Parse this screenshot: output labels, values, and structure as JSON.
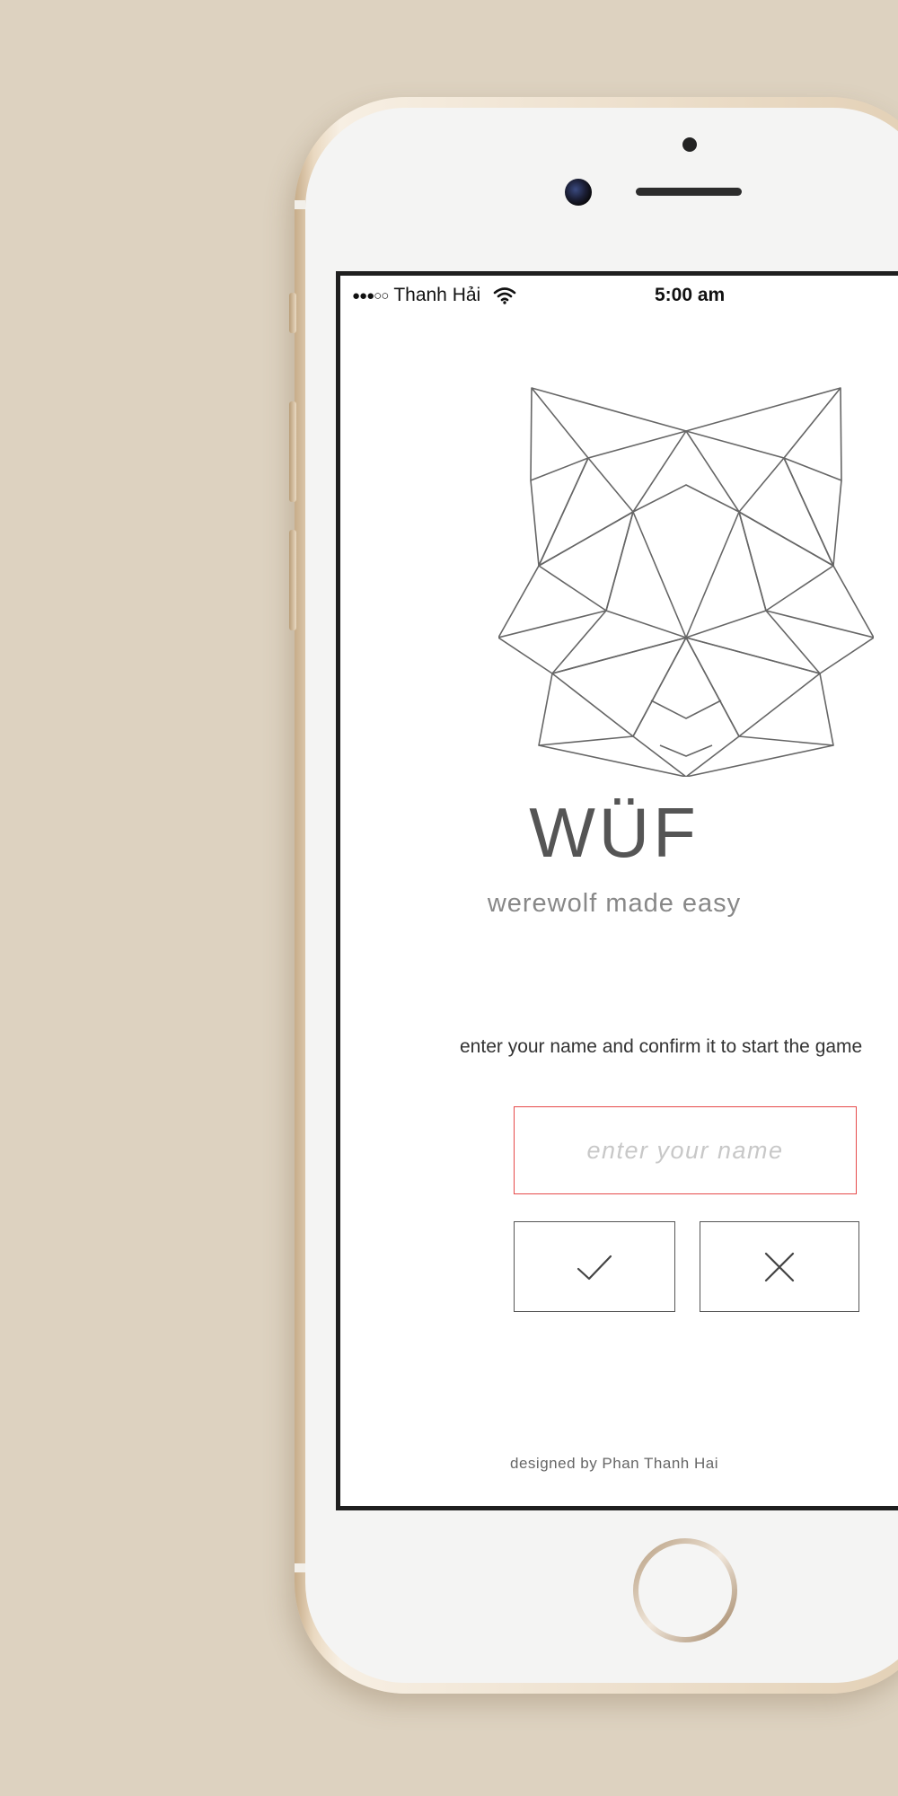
{
  "colors": {
    "background": "#ddd2c0",
    "phone_gold": "#e2cfb4",
    "input_border_accent": "#e64a4a",
    "logo_stroke": "#666666",
    "text_primary": "#555555",
    "text_muted": "#888888"
  },
  "status_bar": {
    "signal": "●●●○○",
    "carrier": "Thanh Hải",
    "wifi_icon": "wifi-icon",
    "time": "5:00 am"
  },
  "app": {
    "logo_icon": "geometric-wolf-head-icon",
    "title": "WÜF",
    "subtitle": "werewolf made easy",
    "prompt": "enter your name and confirm it to start the game",
    "name_input": {
      "value": "",
      "placeholder": "enter your name"
    },
    "confirm_icon": "check-icon",
    "cancel_icon": "close-icon",
    "credit": "designed by Phan Thanh Hai"
  }
}
